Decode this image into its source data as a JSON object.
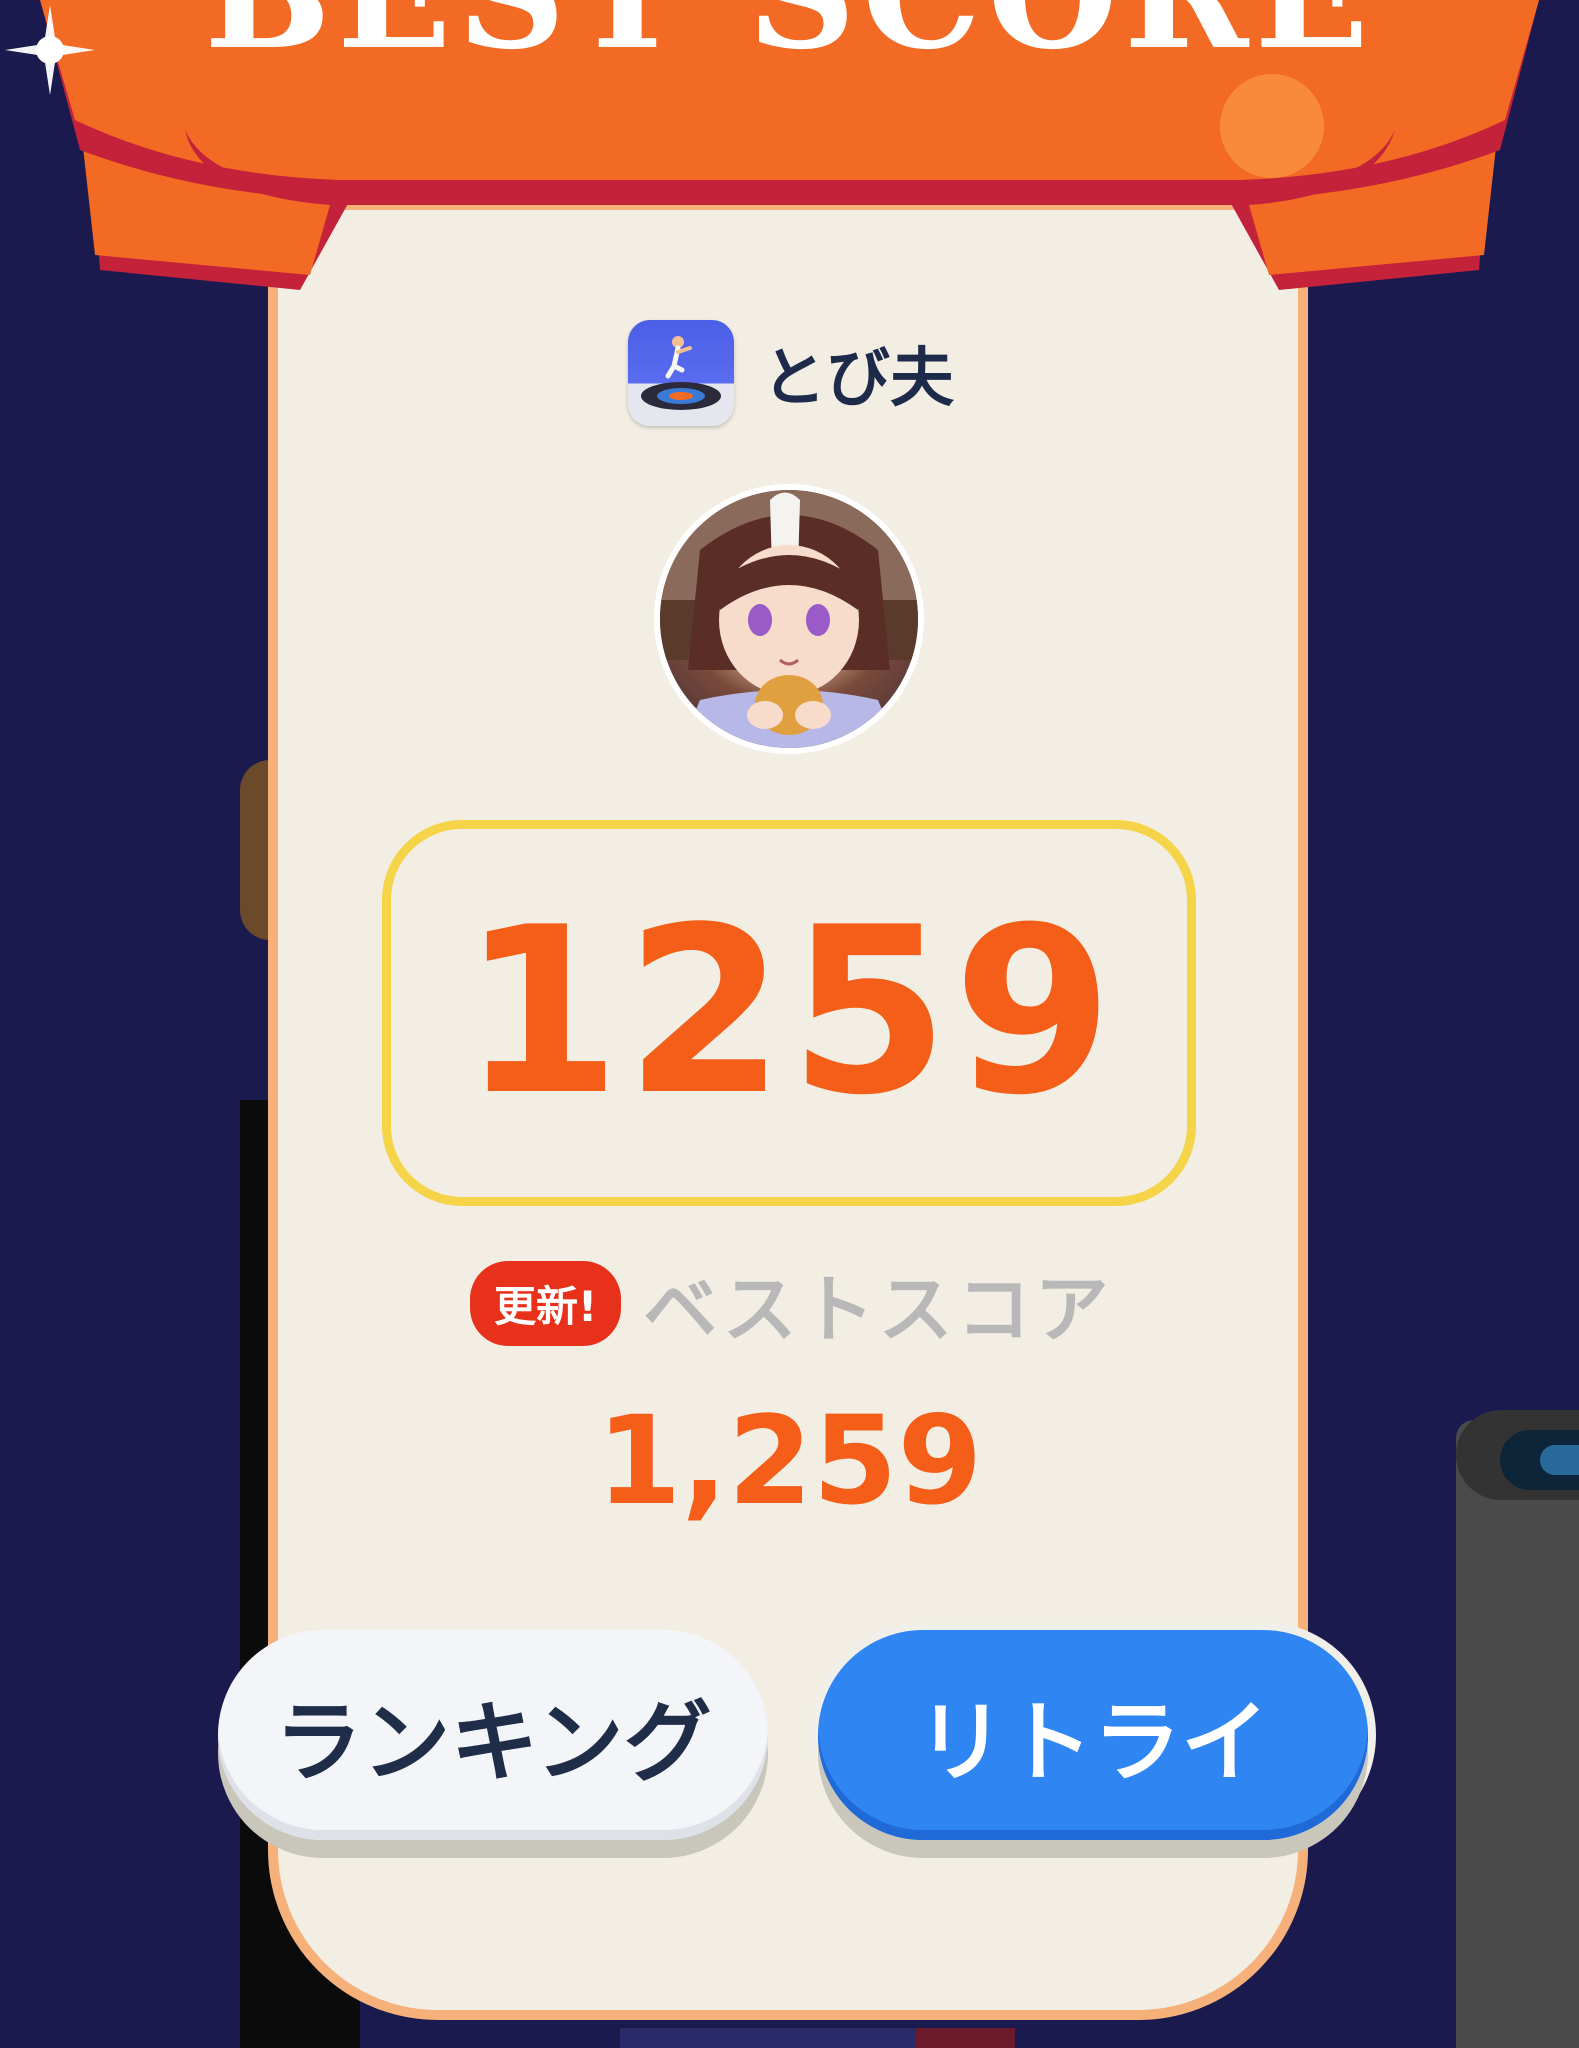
{
  "banner": {
    "title": "BEST SCORE"
  },
  "player": {
    "name": "とび夫"
  },
  "score": {
    "current": "1259"
  },
  "best": {
    "badge": "更新!",
    "label": "ベストスコア",
    "value": "1,259"
  },
  "buttons": {
    "ranking": "ランキング",
    "retry": "リトライ"
  },
  "colors": {
    "background": "#1a1a4e",
    "card": "#f3eee4",
    "ribbon": "#f26a24",
    "ribbon_shadow": "#c4213a",
    "score_text": "#f45e18",
    "score_border": "#f5d44a",
    "badge": "#e8311a",
    "retry_button": "#2f86f3"
  }
}
